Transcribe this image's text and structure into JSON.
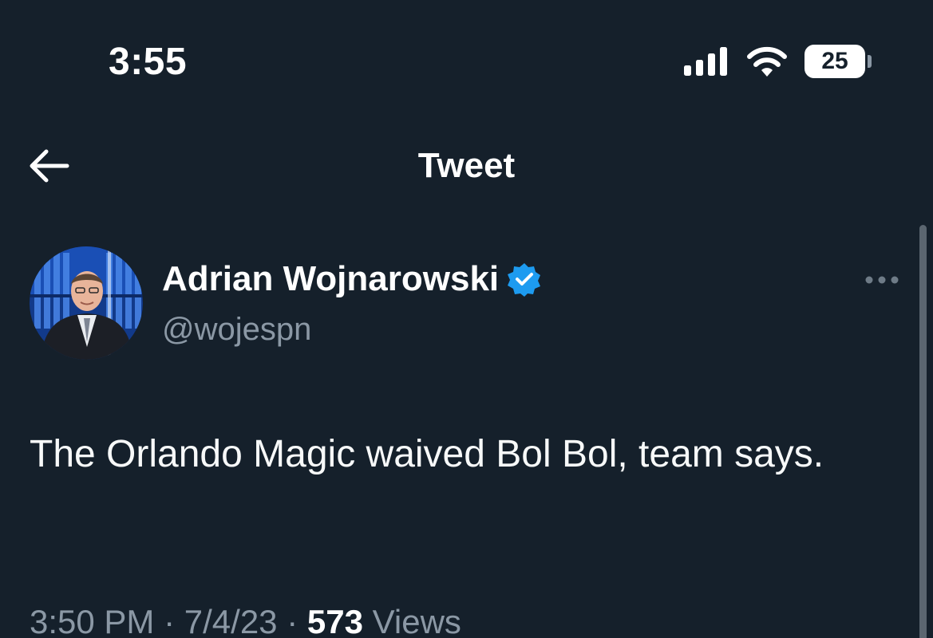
{
  "status_bar": {
    "time": "3:55",
    "battery_level": "25",
    "icons": [
      "signal-icon",
      "wifi-icon",
      "battery-icon"
    ]
  },
  "nav": {
    "title": "Tweet",
    "back_icon": "arrow-left-icon"
  },
  "tweet": {
    "author": {
      "name": "Adrian Wojnarowski",
      "handle": "@wojespn",
      "verified": true,
      "verified_color": "#1d9bf0"
    },
    "text": "The Orlando Magic waived Bol Bol, team says.",
    "meta": {
      "time": "3:50 PM",
      "separator": "·",
      "date": "7/4/23",
      "views_count": "573",
      "views_label": "Views"
    },
    "more_icon": "ellipsis-icon"
  },
  "colors": {
    "background": "#15202b",
    "text_primary": "#f7f9f9",
    "text_secondary": "#8b98a5",
    "accent": "#1d9bf0"
  }
}
